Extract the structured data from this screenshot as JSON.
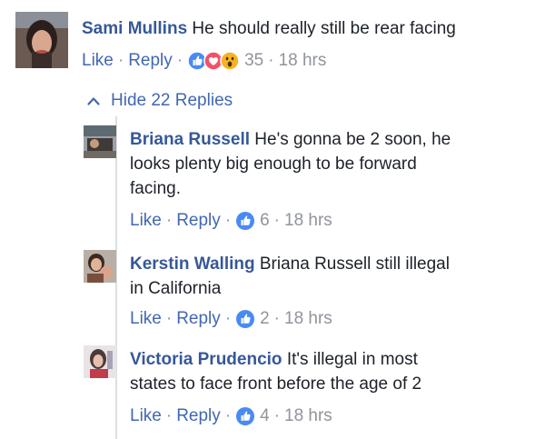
{
  "comments": [
    {
      "author": "Sami Mullins",
      "text": "He should really still be rear facing",
      "like": "Like",
      "reply": "Reply",
      "reactions": [
        "like-icon",
        "love-icon",
        "wow-icon"
      ],
      "count": "35",
      "time": "18 hrs"
    }
  ],
  "thread": {
    "toggle_label": "Hide 22 Replies",
    "toggle_icon": "chevron-up-icon"
  },
  "replies": [
    {
      "author": "Briana Russell",
      "line1": "He's gonna be 2 soon, he",
      "line2": "looks plenty big enough to be forward",
      "line3": "facing.",
      "like": "Like",
      "reply": "Reply",
      "reactions": [
        "like-icon"
      ],
      "count": "6",
      "time": "18 hrs"
    },
    {
      "author": "Kerstin Walling",
      "line1": "Briana Russell still illegal",
      "line2": "in California",
      "like": "Like",
      "reply": "Reply",
      "reactions": [
        "like-icon"
      ],
      "count": "2",
      "time": "18 hrs"
    },
    {
      "author": "Victoria Prudencio",
      "line1": "It's illegal in most",
      "line2": "states to face front before the age of 2",
      "like": "Like",
      "reply": "Reply",
      "reactions": [
        "like-icon"
      ],
      "count": "4",
      "time": "18 hrs"
    }
  ],
  "separator": "·",
  "colors": {
    "link": "#4267b2",
    "author": "#365899",
    "meta": "#90949c",
    "like_badge": "#4a8af4",
    "love_badge": "#f25268",
    "wow_badge": "#f7b125"
  }
}
